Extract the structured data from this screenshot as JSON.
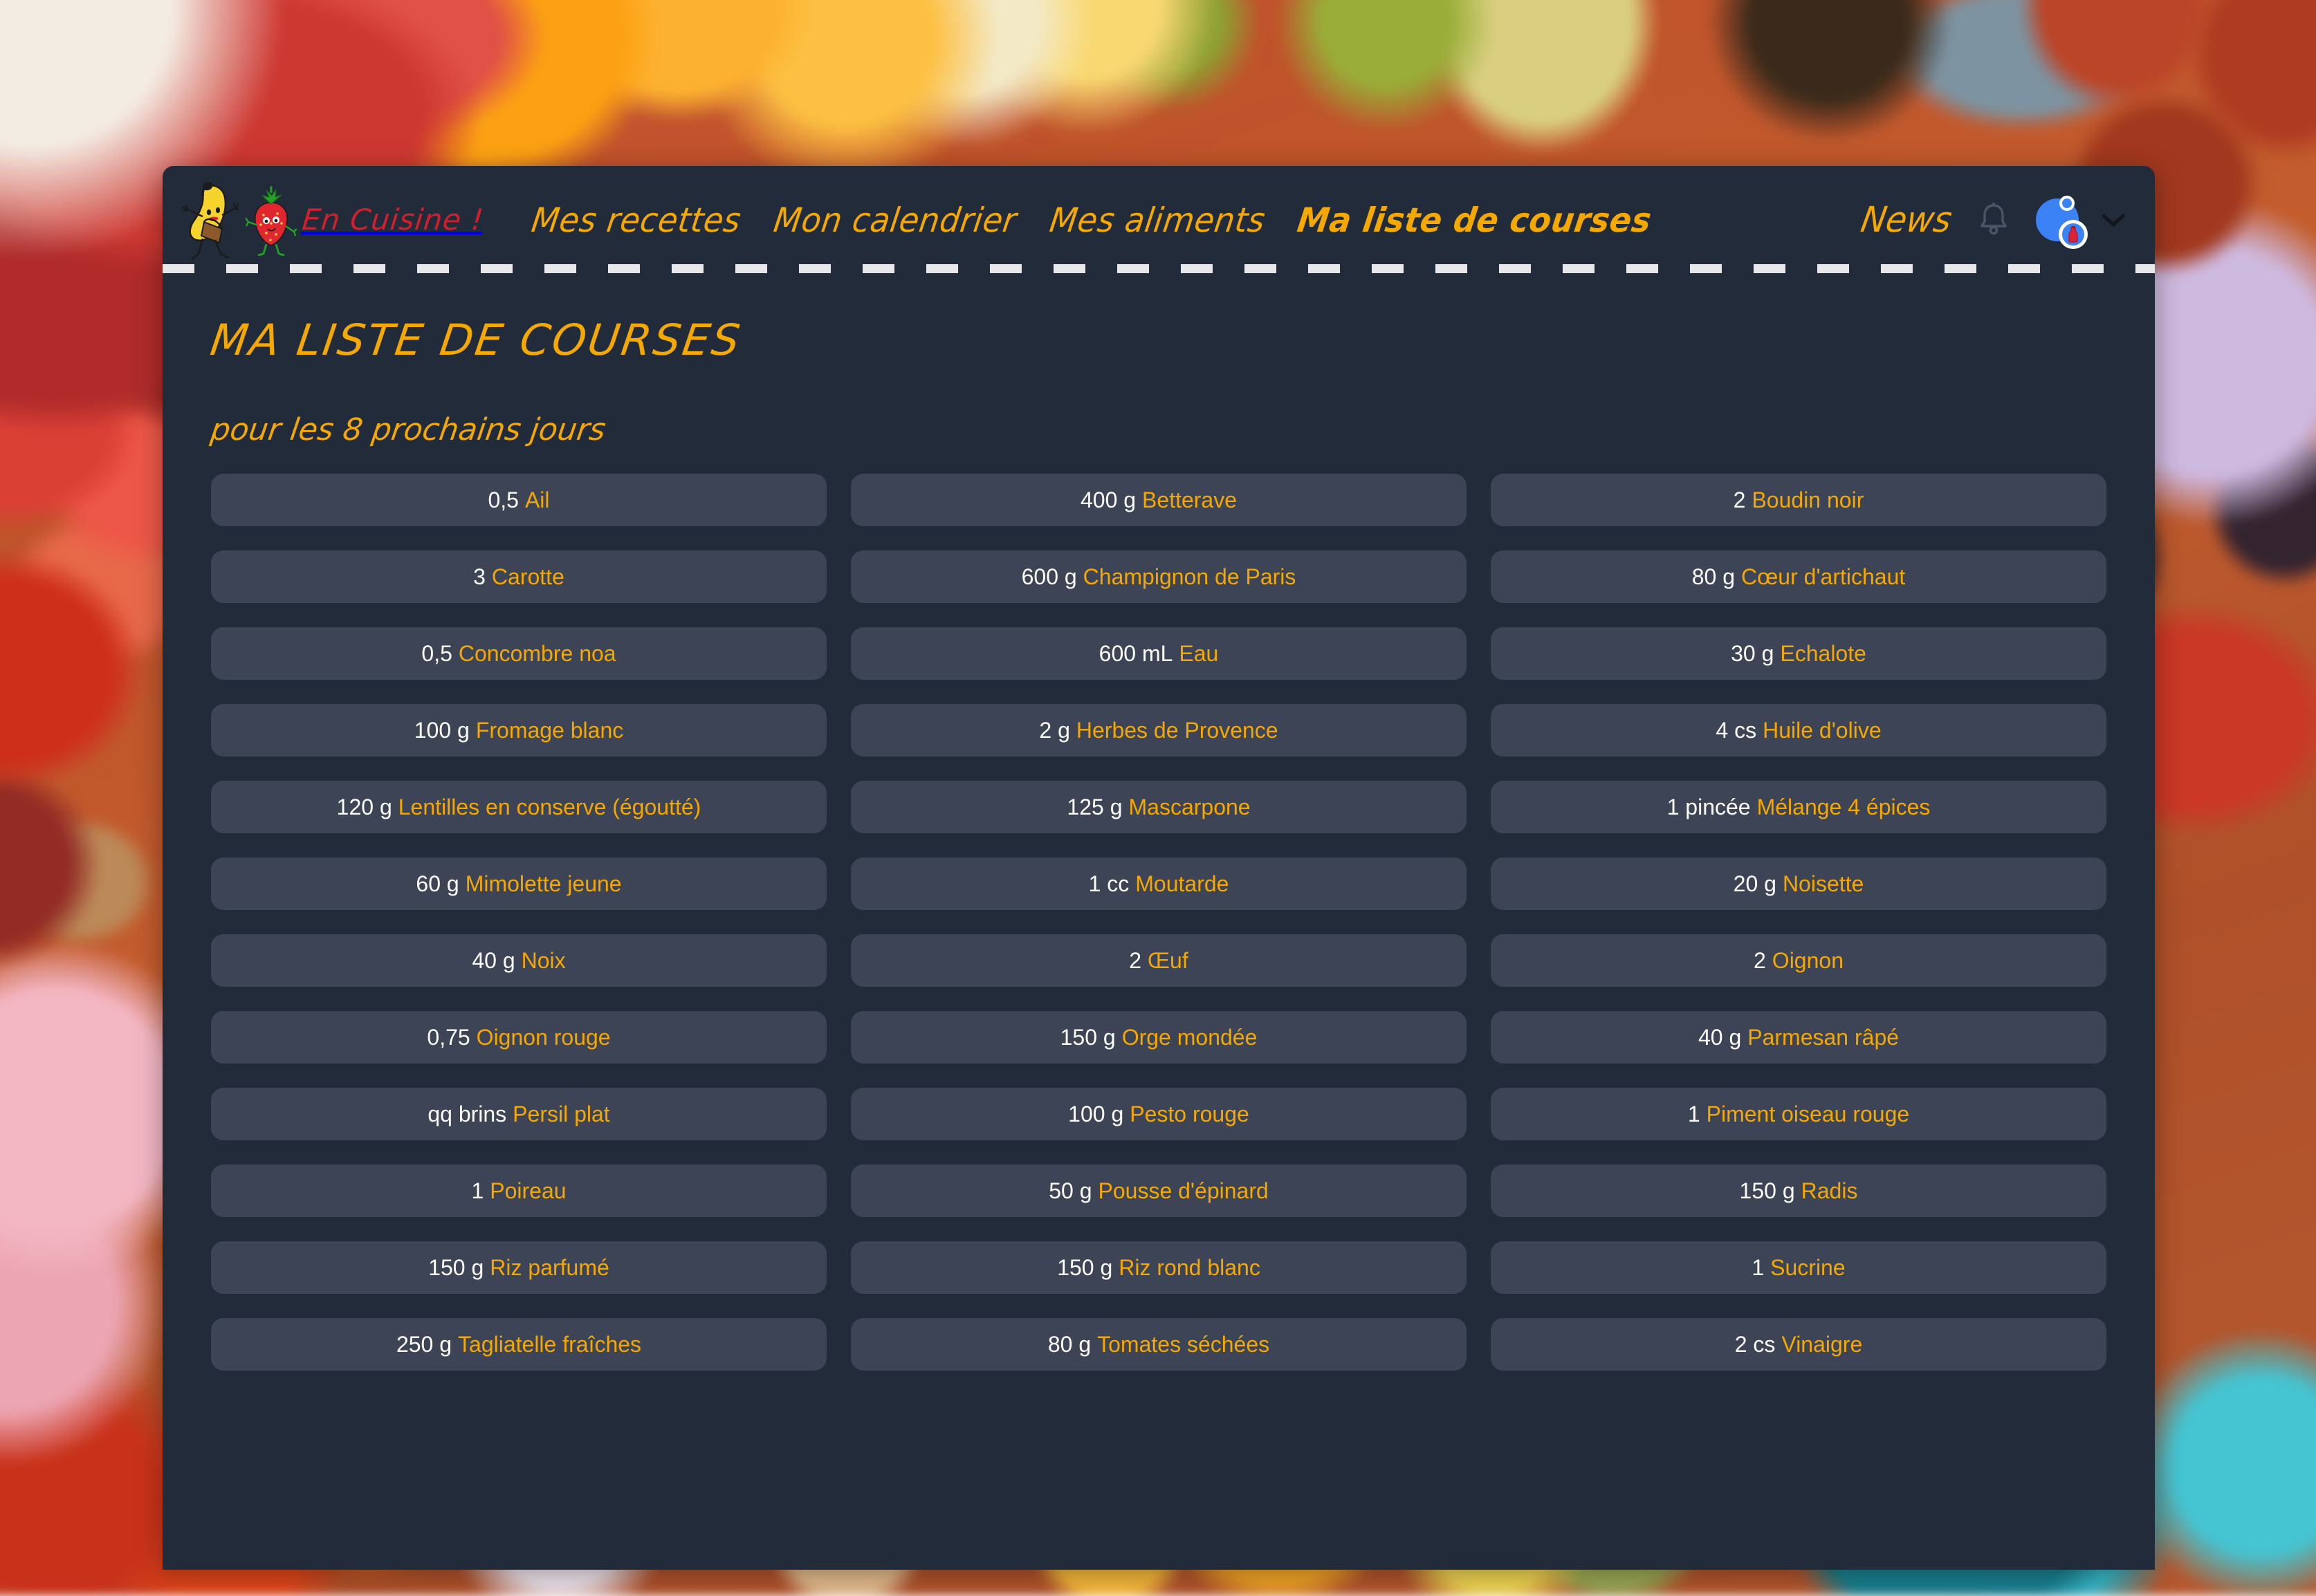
{
  "navbar": {
    "brand_name": "En Cuisine !",
    "mascot_banana": "dancing-banana-mascot",
    "mascot_strawberry": "strawberry-mascot",
    "links": [
      {
        "label": "Mes recettes",
        "active": false
      },
      {
        "label": "Mon calendrier",
        "active": false
      },
      {
        "label": "Mes aliments",
        "active": false
      },
      {
        "label": "Ma liste de courses",
        "active": true
      }
    ],
    "news_label": "News",
    "bell_icon": "bell-icon",
    "avatar_icon": "user-avatar",
    "chevron_icon": "chevron-down-icon",
    "accent_yellow": "#f5a800",
    "brand_red": "#d21f2e",
    "avatar_blue": "#3b82f6"
  },
  "page": {
    "title": "MA LISTE DE COURSES",
    "subtitle": "pour les 8 prochains jours",
    "card_bg": "#222b3a",
    "item_bg": "#3c4456"
  },
  "grocery_list": {
    "column_1": [
      {
        "qty": "0,5",
        "name": "Ail"
      },
      {
        "qty": "3",
        "name": "Carotte"
      },
      {
        "qty": "0,5",
        "name": "Concombre noa"
      },
      {
        "qty": "100 g",
        "name": "Fromage blanc"
      },
      {
        "qty": "120 g",
        "name": "Lentilles en conserve (égoutté)"
      },
      {
        "qty": "60 g",
        "name": "Mimolette jeune"
      },
      {
        "qty": "40 g",
        "name": "Noix"
      },
      {
        "qty": "0,75",
        "name": "Oignon rouge"
      },
      {
        "qty": "qq brins",
        "name": "Persil plat"
      },
      {
        "qty": "1",
        "name": "Poireau"
      },
      {
        "qty": "150 g",
        "name": "Riz parfumé"
      },
      {
        "qty": "250 g",
        "name": "Tagliatelle fraîches"
      }
    ],
    "column_2": [
      {
        "qty": "400 g",
        "name": "Betterave"
      },
      {
        "qty": "600 g",
        "name": "Champignon de Paris"
      },
      {
        "qty": "600 mL",
        "name": "Eau"
      },
      {
        "qty": "2 g",
        "name": "Herbes de Provence"
      },
      {
        "qty": "125 g",
        "name": "Mascarpone"
      },
      {
        "qty": "1 cc",
        "name": "Moutarde"
      },
      {
        "qty": "2",
        "name": "Œuf"
      },
      {
        "qty": "150 g",
        "name": "Orge mondée"
      },
      {
        "qty": "100 g",
        "name": "Pesto rouge"
      },
      {
        "qty": "50 g",
        "name": "Pousse d'épinard"
      },
      {
        "qty": "150 g",
        "name": "Riz rond blanc"
      },
      {
        "qty": "80 g",
        "name": "Tomates séchées"
      }
    ],
    "column_3": [
      {
        "qty": "2",
        "name": "Boudin noir"
      },
      {
        "qty": "80 g",
        "name": "Cœur d'artichaut"
      },
      {
        "qty": "30 g",
        "name": "Echalote"
      },
      {
        "qty": "4 cs",
        "name": "Huile d'olive"
      },
      {
        "qty": "1 pincée",
        "name": "Mélange 4 épices"
      },
      {
        "qty": "20 g",
        "name": "Noisette"
      },
      {
        "qty": "2",
        "name": "Oignon"
      },
      {
        "qty": "40 g",
        "name": "Parmesan râpé"
      },
      {
        "qty": "1",
        "name": "Piment oiseau rouge"
      },
      {
        "qty": "150 g",
        "name": "Radis"
      },
      {
        "qty": "1",
        "name": "Sucrine"
      },
      {
        "qty": "2 cs",
        "name": "Vinaigre"
      }
    ]
  }
}
